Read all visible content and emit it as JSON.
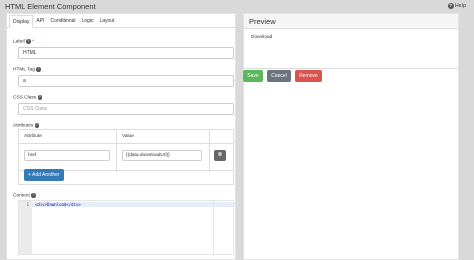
{
  "app_title": "HTML Element Component",
  "help_label": "Help",
  "tabs": [
    "Display",
    "API",
    "Conditional",
    "Logic",
    "Layout"
  ],
  "fields": {
    "label_label": "Label",
    "label_value": "HTML",
    "tag_label": "HTML Tag",
    "tag_value": "a",
    "css_label": "CSS Class",
    "css_placeholder": "CSS Class",
    "attrs_label": "Attributes",
    "attr_col_attribute": "Attribute",
    "attr_col_value": "Value",
    "attr_row_attribute": "href",
    "attr_row_value": "{{data.downloadUrl}}",
    "add_another": "Add Another",
    "content_label": "Content"
  },
  "editor": {
    "line_number": "1",
    "code": "<div>Download</div>"
  },
  "preview": {
    "title": "Preview",
    "content": "Download"
  },
  "actions": {
    "save": "Save",
    "cancel": "Cancel",
    "remove": "Remove"
  },
  "colors": {
    "save": "#5cb85c",
    "cancel": "#6c757d",
    "remove": "#d9534f",
    "primary": "#337ab7"
  }
}
